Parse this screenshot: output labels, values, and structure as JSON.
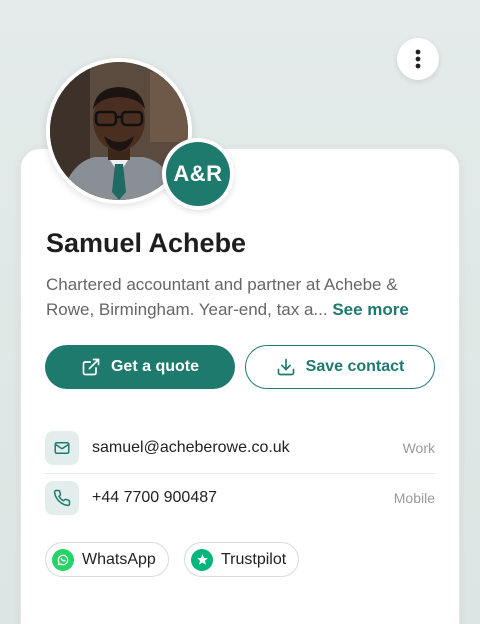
{
  "profile": {
    "name": "Samuel Achebe",
    "bio": "Chartered accountant and partner at Achebe & Rowe, Birmingham. Year-end, tax a...",
    "see_more": "See more",
    "logo_text": "A&R"
  },
  "actions": {
    "quote_label": "Get a quote",
    "save_label": "Save contact"
  },
  "contacts": [
    {
      "icon": "mail-icon",
      "value": "samuel@acheberowe.co.uk",
      "tag": "Work"
    },
    {
      "icon": "phone-icon",
      "value": "+44 7700 900487",
      "tag": "Mobile"
    }
  ],
  "links": [
    {
      "icon": "whatsapp-icon",
      "label": "WhatsApp",
      "color": "#25D366"
    },
    {
      "icon": "trustpilot-icon",
      "label": "Trustpilot",
      "color": "#00B67A"
    }
  ],
  "colors": {
    "accent": "#1f7a6e"
  }
}
